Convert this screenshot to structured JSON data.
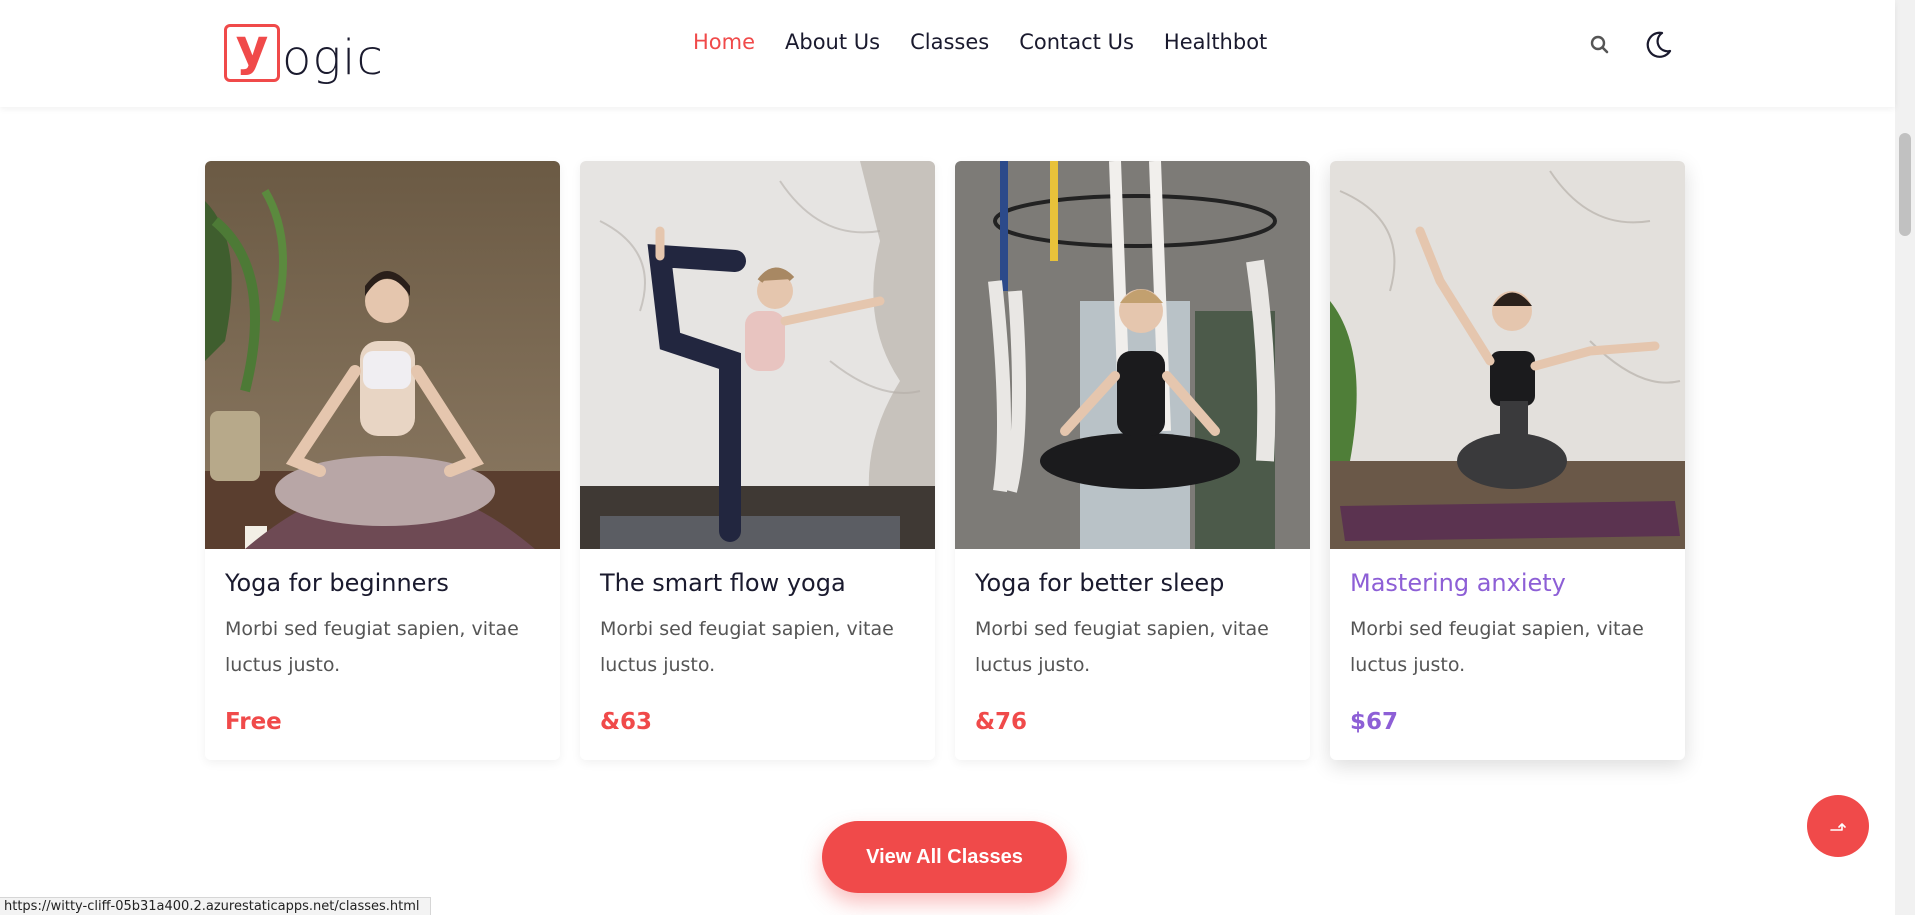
{
  "header": {
    "logo_letter": "y",
    "logo_text": "ogic",
    "nav": [
      "Home",
      "About Us",
      "Classes",
      "Contact Us",
      "Healthbot"
    ],
    "active_nav": "Home",
    "search_icon": "search-icon",
    "theme_icon": "moon-icon"
  },
  "classes": [
    {
      "title": "Yoga for beginners",
      "description": "Morbi sed feugiat sapien, vitae luctus justo.",
      "price": "Free"
    },
    {
      "title": "The smart flow yoga",
      "description": "Morbi sed feugiat sapien, vitae luctus justo.",
      "price": "&63"
    },
    {
      "title": "Yoga for better sleep",
      "description": "Morbi sed feugiat sapien, vitae luctus justo.",
      "price": "&76"
    },
    {
      "title": "Mastering anxiety",
      "description": "Morbi sed feugiat sapien, vitae luctus justo.",
      "price": "$67"
    }
  ],
  "view_all_label": "View All Classes",
  "scroll_top_icon": "arrow-up-icon",
  "status_url": "https://witty-cliff-05b31a400.2.azurestaticapps.net/classes.html",
  "colors": {
    "accent": "#f04a4a",
    "hover_accent": "#8d5fd6",
    "text": "#1a1a2e"
  }
}
